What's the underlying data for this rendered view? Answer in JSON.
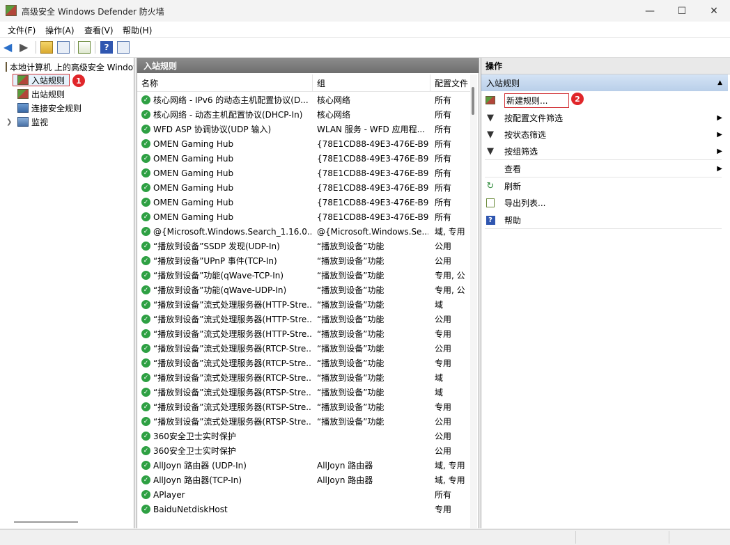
{
  "window": {
    "title": "高级安全 Windows Defender 防火墙"
  },
  "menu": [
    "文件(F)",
    "操作(A)",
    "查看(V)",
    "帮助(H)"
  ],
  "tree": {
    "root": "本地计算机 上的高级安全 Windows Defender 防火墙",
    "items": [
      "入站规则",
      "出站规则",
      "连接安全规则",
      "监视"
    ],
    "badge": "1"
  },
  "center": {
    "header": "入站规则",
    "columns": [
      "名称",
      "组",
      "配置文件"
    ],
    "rows": [
      {
        "name": "核心网络 - IPv6 的动态主机配置协议(D...",
        "group": "核心网络",
        "profile": "所有"
      },
      {
        "name": "核心网络 - 动态主机配置协议(DHCP-In)",
        "group": "核心网络",
        "profile": "所有"
      },
      {
        "name": "WFD ASP 协调协议(UDP 输入)",
        "group": "WLAN 服务 - WFD 应用程...",
        "profile": "所有"
      },
      {
        "name": "OMEN Gaming Hub",
        "group": "{78E1CD88-49E3-476E-B9...",
        "profile": "所有"
      },
      {
        "name": "OMEN Gaming Hub",
        "group": "{78E1CD88-49E3-476E-B9...",
        "profile": "所有"
      },
      {
        "name": "OMEN Gaming Hub",
        "group": "{78E1CD88-49E3-476E-B9...",
        "profile": "所有"
      },
      {
        "name": "OMEN Gaming Hub",
        "group": "{78E1CD88-49E3-476E-B9...",
        "profile": "所有"
      },
      {
        "name": "OMEN Gaming Hub",
        "group": "{78E1CD88-49E3-476E-B9...",
        "profile": "所有"
      },
      {
        "name": "OMEN Gaming Hub",
        "group": "{78E1CD88-49E3-476E-B9...",
        "profile": "所有"
      },
      {
        "name": "@{Microsoft.Windows.Search_1.16.0....",
        "group": "@{Microsoft.Windows.Se...",
        "profile": "域, 专用"
      },
      {
        "name": "“播放到设备”SSDP 发现(UDP-In)",
        "group": "“播放到设备”功能",
        "profile": "公用"
      },
      {
        "name": "“播放到设备”UPnP 事件(TCP-In)",
        "group": "“播放到设备”功能",
        "profile": "公用"
      },
      {
        "name": "“播放到设备”功能(qWave-TCP-In)",
        "group": "“播放到设备”功能",
        "profile": "专用, 公"
      },
      {
        "name": "“播放到设备”功能(qWave-UDP-In)",
        "group": "“播放到设备”功能",
        "profile": "专用, 公"
      },
      {
        "name": "“播放到设备”流式处理服务器(HTTP-Stre...",
        "group": "“播放到设备”功能",
        "profile": "域"
      },
      {
        "name": "“播放到设备”流式处理服务器(HTTP-Stre...",
        "group": "“播放到设备”功能",
        "profile": "公用"
      },
      {
        "name": "“播放到设备”流式处理服务器(HTTP-Stre...",
        "group": "“播放到设备”功能",
        "profile": "专用"
      },
      {
        "name": "“播放到设备”流式处理服务器(RTCP-Stre...",
        "group": "“播放到设备”功能",
        "profile": "公用"
      },
      {
        "name": "“播放到设备”流式处理服务器(RTCP-Stre...",
        "group": "“播放到设备”功能",
        "profile": "专用"
      },
      {
        "name": "“播放到设备”流式处理服务器(RTCP-Stre...",
        "group": "“播放到设备”功能",
        "profile": "域"
      },
      {
        "name": "“播放到设备”流式处理服务器(RTSP-Stre...",
        "group": "“播放到设备”功能",
        "profile": "域"
      },
      {
        "name": "“播放到设备”流式处理服务器(RTSP-Stre...",
        "group": "“播放到设备”功能",
        "profile": "专用"
      },
      {
        "name": "“播放到设备”流式处理服务器(RTSP-Stre...",
        "group": "“播放到设备”功能",
        "profile": "公用"
      },
      {
        "name": "360安全卫士实时保护",
        "group": "",
        "profile": "公用"
      },
      {
        "name": "360安全卫士实时保护",
        "group": "",
        "profile": "公用"
      },
      {
        "name": "AllJoyn 路由器 (UDP-In)",
        "group": "AllJoyn 路由器",
        "profile": "域, 专用"
      },
      {
        "name": "AllJoyn 路由器(TCP-In)",
        "group": "AllJoyn 路由器",
        "profile": "域, 专用"
      },
      {
        "name": "APlayer",
        "group": "",
        "profile": "所有"
      },
      {
        "name": "BaiduNetdiskHost",
        "group": "",
        "profile": "专用"
      }
    ]
  },
  "actions": {
    "header": "操作",
    "section": "入站规则",
    "badge": "2",
    "items": [
      {
        "label": "新建规则...",
        "icon": "new-rule-icon"
      },
      {
        "label": "按配置文件筛选",
        "icon": "filter-icon",
        "submenu": true
      },
      {
        "label": "按状态筛选",
        "icon": "filter-icon",
        "submenu": true
      },
      {
        "label": "按组筛选",
        "icon": "filter-icon",
        "submenu": true
      },
      {
        "label": "查看",
        "icon": "",
        "submenu": true
      },
      {
        "label": "刷新",
        "icon": "refresh-icon"
      },
      {
        "label": "导出列表...",
        "icon": "export-icon"
      },
      {
        "label": "帮助",
        "icon": "help-icon"
      }
    ]
  }
}
